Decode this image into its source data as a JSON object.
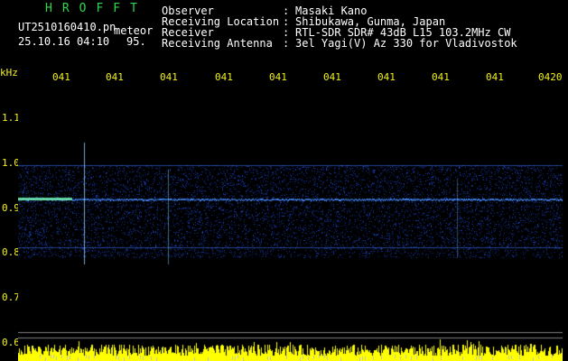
{
  "header": {
    "brand": "HROFFT",
    "filename": "UT2510160410.pn",
    "tag": "meteor",
    "datetime": "25.10.16 04:10",
    "count": "95."
  },
  "station": {
    "rows": [
      {
        "label": "Observer",
        "value": "Masaki Kano"
      },
      {
        "label": "Receiving Location",
        "value": "Shibukawa, Gunma, Japan"
      },
      {
        "label": "Receiver",
        "value": "RTL-SDR SDR# 43dB L15 103.2MHz CW"
      },
      {
        "label": "Receiving Antenna",
        "value": "3el Yagi(V) Az 330 for Vladivostok"
      }
    ],
    "colon": ":"
  },
  "axis": {
    "unit": "kHz",
    "y_ticks": [
      "1.1",
      "1.0",
      "0.9",
      "0.8",
      "0.7",
      "0.6"
    ],
    "x_ticks": [
      "041",
      "041",
      "041",
      "041",
      "041",
      "041",
      "041",
      "041",
      "041",
      "0420"
    ]
  },
  "colors": {
    "green": "#2fd84a",
    "yellow": "#f2f21a",
    "signal": "#3a7bff",
    "bars": "#ffff00",
    "background": "#000000"
  }
}
